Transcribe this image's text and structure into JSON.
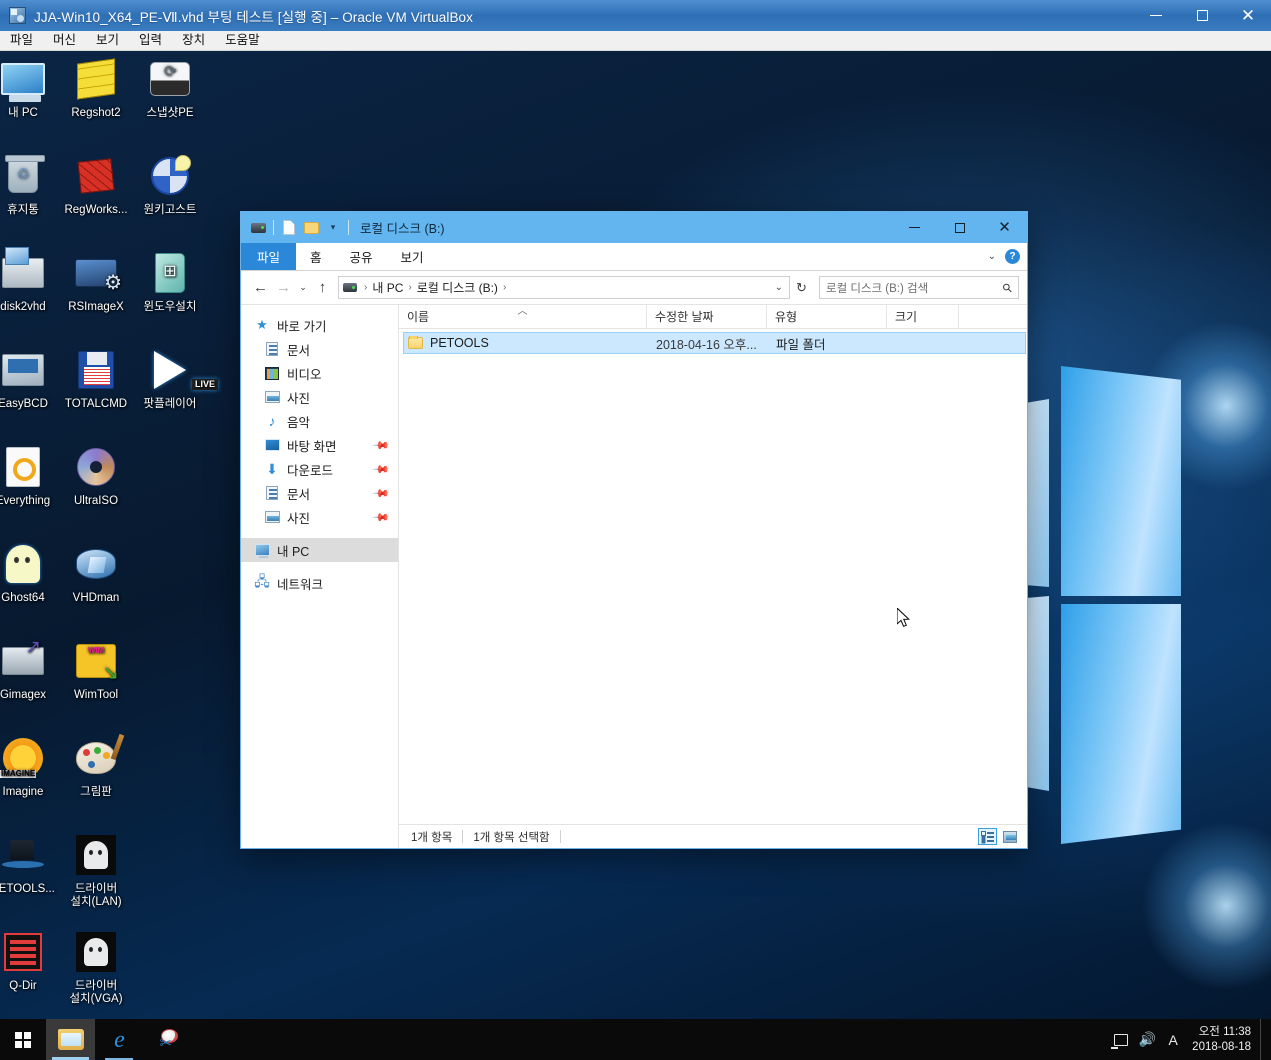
{
  "vbox": {
    "title": "JJA-Win10_X64_PE-Ⅶ.vhd 부팅 테스트  [실행 중] – Oracle VM VirtualBox",
    "menu": [
      "파일",
      "머신",
      "보기",
      "입력",
      "장치",
      "도움말"
    ],
    "window_controls": {
      "minimize": "–",
      "maximize": "□",
      "close": "✕"
    }
  },
  "desktop": {
    "icons": [
      {
        "label": "내 PC",
        "icon": "my-computer-icon"
      },
      {
        "label": "Regshot2",
        "icon": "regshot-icon"
      },
      {
        "label": "스냅샷PE",
        "icon": "snapshot-pe-icon"
      },
      {
        "label": "휴지통",
        "icon": "recycle-bin-icon"
      },
      {
        "label": "RegWorks...",
        "icon": "regworks-icon"
      },
      {
        "label": "원키고스트",
        "icon": "onekey-ghost-icon"
      },
      {
        "label": "disk2vhd",
        "icon": "disk2vhd-icon"
      },
      {
        "label": "RSImageX",
        "icon": "rsimagex-icon"
      },
      {
        "label": "윈도우설치",
        "icon": "windows-setup-icon"
      },
      {
        "label": "EasyBCD",
        "icon": "easybcd-icon"
      },
      {
        "label": "TOTALCMD",
        "icon": "totalcmd-icon"
      },
      {
        "label": "팟플레이어",
        "icon": "potplayer-icon"
      },
      {
        "label": "Everything",
        "icon": "everything-icon"
      },
      {
        "label": "UltraISO",
        "icon": "ultraiso-icon"
      },
      {
        "label": "Ghost64",
        "icon": "ghost64-icon"
      },
      {
        "label": "VHDman",
        "icon": "vhdman-icon"
      },
      {
        "label": "Gimagex",
        "icon": "gimagex-icon"
      },
      {
        "label": "WimTool",
        "icon": "wimtool-icon"
      },
      {
        "label": "Imagine",
        "icon": "imagine-icon"
      },
      {
        "label": "그림판",
        "icon": "paint-icon"
      },
      {
        "label": "PETOOLS...",
        "icon": "petools-icon"
      },
      {
        "label": "드라이버\n설치(LAN)",
        "icon": "driver-lan-icon"
      },
      {
        "label": "Q-Dir",
        "icon": "qdir-icon"
      },
      {
        "label": "드라이버\n설치(VGA)",
        "icon": "driver-vga-icon"
      }
    ]
  },
  "explorer": {
    "title": "로컬 디스크 (B:)",
    "window_controls": {
      "minimize": "–",
      "maximize": "□",
      "close": "✕"
    },
    "quick_access": [
      "drive-icon",
      "properties-icon",
      "new-folder-icon",
      "customize-chevron-icon"
    ],
    "ribbon_tabs": [
      {
        "label": "파일",
        "active": true
      },
      {
        "label": "홈",
        "active": false
      },
      {
        "label": "공유",
        "active": false
      },
      {
        "label": "보기",
        "active": false
      }
    ],
    "ribbon_right": {
      "collapse": "⌄",
      "help": "?"
    },
    "address": {
      "back": "←",
      "forward": "→",
      "recent": "⌄",
      "up": "↑",
      "breadcrumbs": [
        "내 PC",
        "로컬 디스크 (B:)"
      ],
      "dropdown": "⌄",
      "refresh": "↻"
    },
    "search": {
      "placeholder": "로컬 디스크 (B:) 검색",
      "icon": "search-icon"
    },
    "nav_pane": [
      {
        "label": "바로 가기",
        "level": "root",
        "icon": "star-icon",
        "pinned": false,
        "selected": false
      },
      {
        "label": "문서",
        "level": "child",
        "icon": "documents-icon",
        "pinned": false,
        "selected": false
      },
      {
        "label": "비디오",
        "level": "child",
        "icon": "videos-icon",
        "pinned": false,
        "selected": false
      },
      {
        "label": "사진",
        "level": "child",
        "icon": "pictures-icon",
        "pinned": false,
        "selected": false
      },
      {
        "label": "음악",
        "level": "child",
        "icon": "music-icon",
        "pinned": false,
        "selected": false
      },
      {
        "label": "바탕 화면",
        "level": "child",
        "icon": "desktop-icon",
        "pinned": true,
        "selected": false
      },
      {
        "label": "다운로드",
        "level": "child",
        "icon": "downloads-icon",
        "pinned": true,
        "selected": false
      },
      {
        "label": "문서",
        "level": "child",
        "icon": "documents-icon",
        "pinned": true,
        "selected": false
      },
      {
        "label": "사진",
        "level": "child",
        "icon": "pictures-icon",
        "pinned": true,
        "selected": false
      },
      {
        "label": "내 PC",
        "level": "root",
        "icon": "this-pc-icon",
        "pinned": false,
        "selected": true
      },
      {
        "label": "네트워크",
        "level": "root",
        "icon": "network-icon",
        "pinned": false,
        "selected": false
      }
    ],
    "columns": [
      {
        "key": "name",
        "label": "이름",
        "sorted": true,
        "sort_dir": "asc"
      },
      {
        "key": "date",
        "label": "수정한 날짜",
        "sorted": false
      },
      {
        "key": "type",
        "label": "유형",
        "sorted": false
      },
      {
        "key": "size",
        "label": "크기",
        "sorted": false
      }
    ],
    "rows": [
      {
        "name": "PETOOLS",
        "date": "2018-04-16 오후...",
        "type": "파일 폴더",
        "size": "",
        "icon": "folder-icon",
        "selected": true
      }
    ],
    "status": {
      "item_count": "1개 항목",
      "selection": "1개 항목 선택함"
    },
    "view_toggles": [
      {
        "name": "details-view",
        "selected": true
      },
      {
        "name": "large-icons-view",
        "selected": false
      }
    ]
  },
  "taskbar": {
    "start": "start-button",
    "items": [
      {
        "name": "file-explorer",
        "state": "active"
      },
      {
        "name": "internet-explorer",
        "state": "open"
      },
      {
        "name": "snipping-tool",
        "state": "open"
      }
    ],
    "tray": [
      {
        "name": "network-icon"
      },
      {
        "name": "volume-icon"
      },
      {
        "name": "ime-indicator",
        "label": "A"
      }
    ],
    "clock": {
      "time": "오전 11:38",
      "date": "2018-08-18"
    }
  },
  "colors": {
    "vbox_title": "#3a7cc0",
    "explorer_title": "#62b5ef",
    "ribbon_active": "#2b88d8",
    "selection": "#cce8ff",
    "taskbar": "#0a0a0a",
    "desktop": "#0b2545"
  }
}
